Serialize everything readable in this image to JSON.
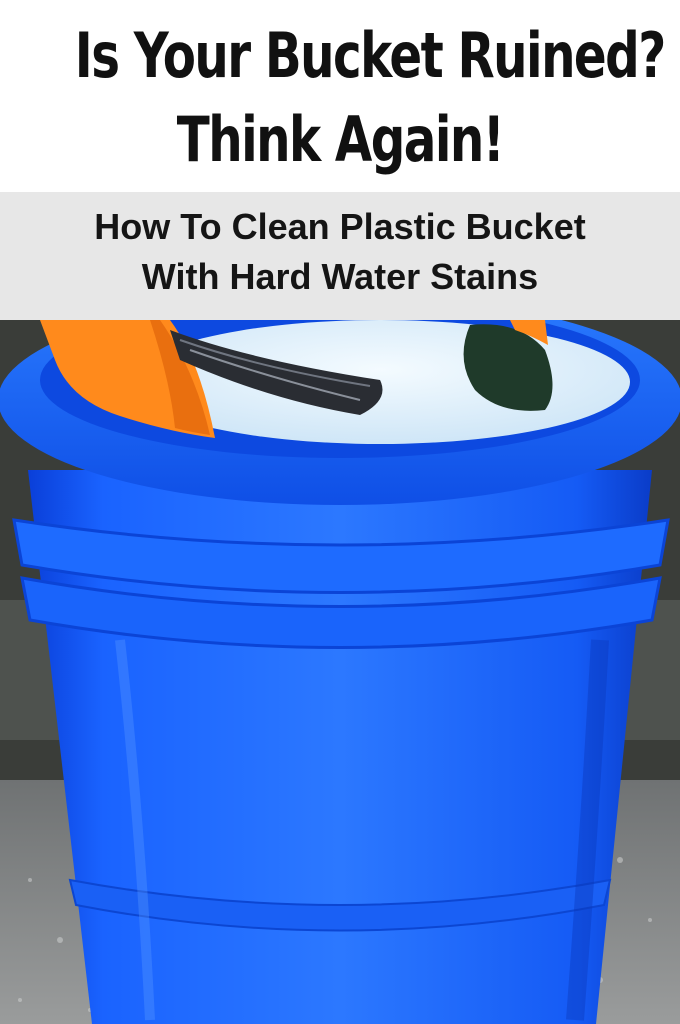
{
  "headline": {
    "line1": "Is Your Bucket Ruined?",
    "line2": "Think Again!"
  },
  "subtitle": {
    "line1": "How To Clean Plastic Bucket",
    "line2": "With Hard Water Stains"
  },
  "colors": {
    "bucket_blue": "#1560ff",
    "band_gray": "#e7e7e7",
    "glove_orange": "#ff8a1c"
  }
}
